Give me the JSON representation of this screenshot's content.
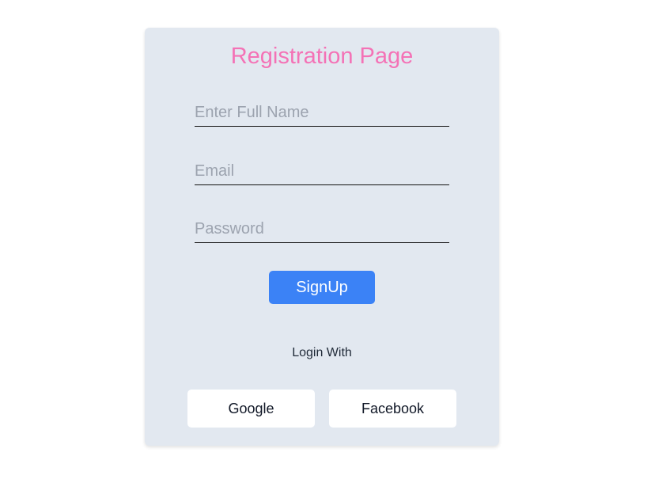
{
  "form": {
    "title": "Registration Page",
    "fields": {
      "full_name": {
        "placeholder": "Enter Full Name",
        "value": ""
      },
      "email": {
        "placeholder": "Email",
        "value": ""
      },
      "password": {
        "placeholder": "Password",
        "value": ""
      }
    },
    "signup_label": "SignUp",
    "login_with_label": "Login With",
    "social": {
      "google_label": "Google",
      "facebook_label": "Facebook"
    }
  },
  "colors": {
    "card_background": "#e2e8f0",
    "title": "#f472b6",
    "primary_button": "#3b82f6"
  }
}
